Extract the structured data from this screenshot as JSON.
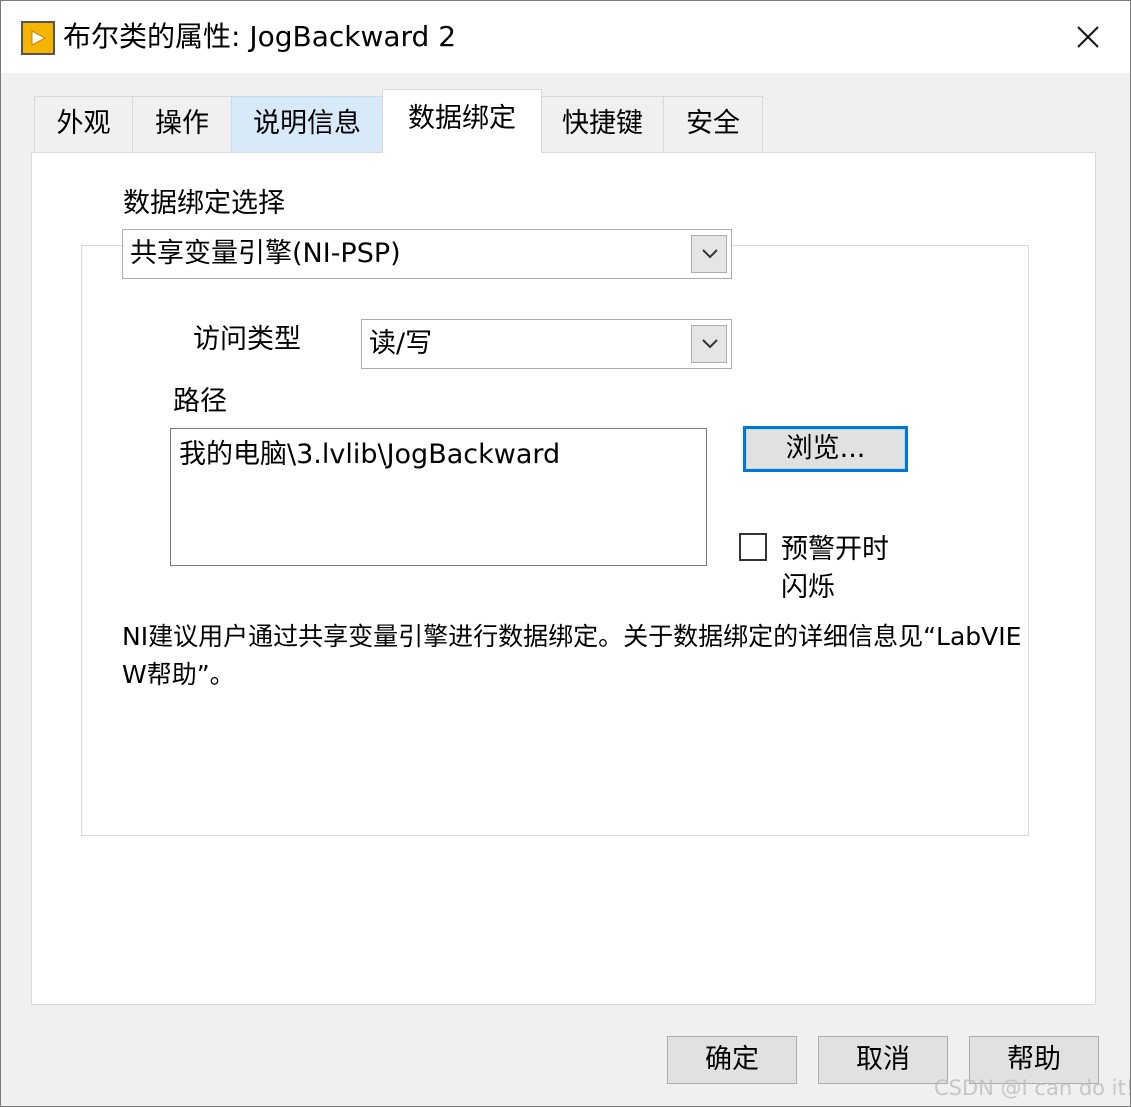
{
  "window": {
    "title": "布尔类的属性: JogBackward 2",
    "icon": "labview-vi-icon",
    "close_icon": "close-icon"
  },
  "tabs": [
    {
      "label": "外观",
      "state": "normal"
    },
    {
      "label": "操作",
      "state": "normal"
    },
    {
      "label": "说明信息",
      "state": "hover"
    },
    {
      "label": "数据绑定",
      "state": "active"
    },
    {
      "label": "快捷键",
      "state": "normal"
    },
    {
      "label": "安全",
      "state": "normal"
    }
  ],
  "binding": {
    "selection_label": "数据绑定选择",
    "selection_value": "共享变量引擎(NI-PSP)",
    "access_label": "访问类型",
    "access_value": "读/写",
    "path_label": "路径",
    "path_value": "我的电脑\\3.lvlib\\JogBackward",
    "browse_label": "浏览...",
    "blink_line1": "预警开时",
    "blink_line2": "闪烁",
    "blink_checked": false,
    "note": "NI建议用户通过共享变量引擎进行数据绑定。关于数据绑定的详细信息见“LabVIEW帮助”。"
  },
  "footer": {
    "ok_label": "确定",
    "cancel_label": "取消",
    "help_label": "帮助"
  },
  "watermark": "CSDN @I can do it!",
  "colors": {
    "accent": "#0078d7",
    "tab_hover": "#d8eaf9",
    "dialog_bg": "#f0f0f0"
  }
}
